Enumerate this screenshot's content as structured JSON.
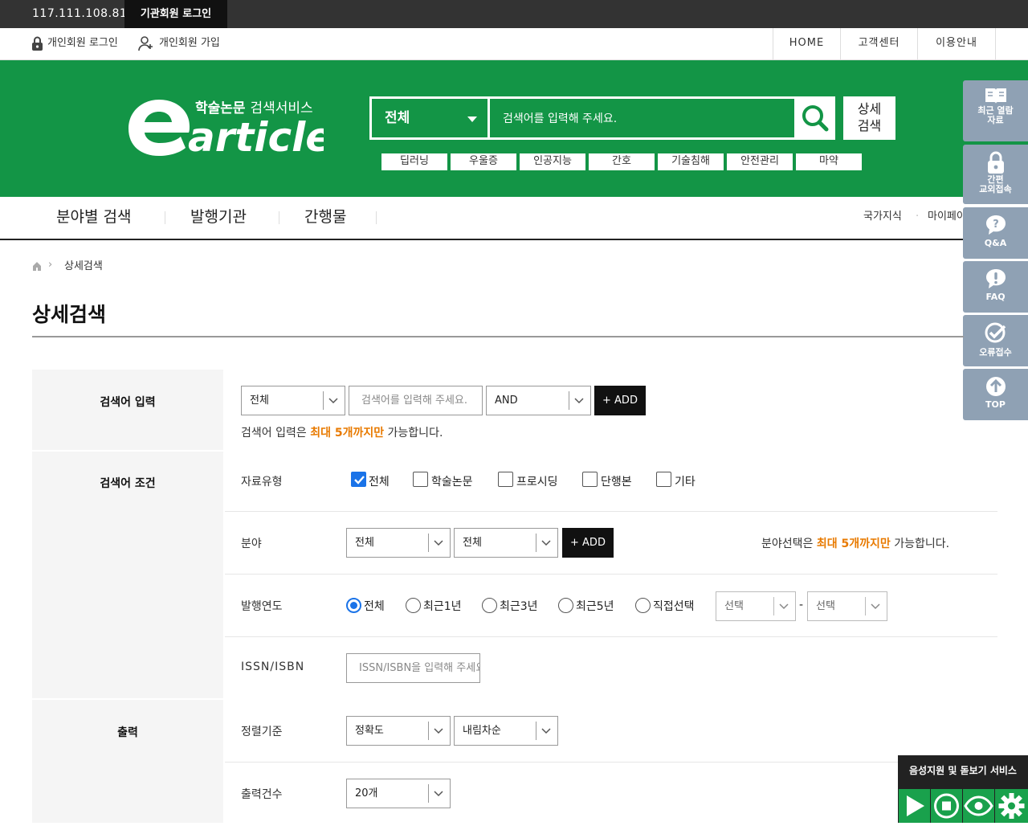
{
  "topbar": {
    "ip": "117.111.108.81",
    "institution_login": "기관회원 로그인"
  },
  "utilbar": {
    "personal_login": "개인회원 로그인",
    "personal_join": "개인회원 가입",
    "home": "HOME",
    "customer_center": "고객센터",
    "guide": "이용안내"
  },
  "header": {
    "logo_sub_bold": "학술논문",
    "logo_sub_light": "검색서비스",
    "logo_text": "article",
    "search_scope": "전체",
    "search_placeholder": "검색어를 입력해 주세요.",
    "detail_search_line1": "상세",
    "detail_search_line2": "검색",
    "keywords": [
      "딥러닝",
      "우울증",
      "인공지능",
      "간호",
      "기술침해",
      "안전관리",
      "마약"
    ]
  },
  "nav": {
    "items": [
      "분야별 검색",
      "발행기관",
      "간행물"
    ],
    "right": [
      "국가지식",
      "마이페이"
    ]
  },
  "quickmenu": [
    {
      "label1": "최근 열람",
      "label2": "자료",
      "icon": "book-icon"
    },
    {
      "label1": "간편",
      "label2": "교외접속",
      "icon": "lock-icon"
    },
    {
      "label1": "Q&A",
      "label2": "",
      "icon": "question-icon"
    },
    {
      "label1": "FAQ",
      "label2": "",
      "icon": "exclamation-icon"
    },
    {
      "label1": "오류접수",
      "label2": "",
      "icon": "check-icon"
    },
    {
      "label1": "TOP",
      "label2": "",
      "icon": "arrow-up-icon"
    }
  ],
  "breadcrumb": {
    "current": "상세검색"
  },
  "page_title": "상세검색",
  "form": {
    "search_input": {
      "label": "검색어 입력",
      "scope": "전체",
      "placeholder": "검색어를 입력해 주세요.",
      "operator": "AND",
      "add": "+ ADD",
      "note_prefix": "검색어 입력은 ",
      "note_highlight": "최대 5개까지만",
      "note_suffix": " 가능합니다."
    },
    "conditions": {
      "label": "검색어 조건",
      "type_label": "자료유형",
      "types": [
        {
          "label": "전체",
          "checked": true
        },
        {
          "label": "학술논문",
          "checked": false
        },
        {
          "label": "프로시딩",
          "checked": false
        },
        {
          "label": "단행본",
          "checked": false
        },
        {
          "label": "기타",
          "checked": false
        }
      ],
      "field_label": "분야",
      "field1": "전체",
      "field2": "전체",
      "field_add": "+ ADD",
      "field_note_prefix": "분야선택은 ",
      "field_note_highlight": "최대 5개까지만",
      "field_note_suffix": " 가능합니다.",
      "year_label": "발행연도",
      "years": [
        {
          "label": "전체",
          "selected": true
        },
        {
          "label": "최근1년",
          "selected": false
        },
        {
          "label": "최근3년",
          "selected": false
        },
        {
          "label": "최근5년",
          "selected": false
        },
        {
          "label": "직접선택",
          "selected": false
        }
      ],
      "year_from": "선택",
      "year_dash": "-",
      "year_to": "선택",
      "issn_label": "ISSN/ISBN",
      "issn_placeholder": "ISSN/ISBN을 입력해 주세요."
    },
    "output": {
      "label": "출력",
      "sort_label": "정렬기준",
      "sort_by": "정확도",
      "sort_order": "내림차순",
      "count_label": "출력건수",
      "count": "20개"
    }
  },
  "voice": {
    "title": "음성지원 및 돋보기 서비스"
  }
}
